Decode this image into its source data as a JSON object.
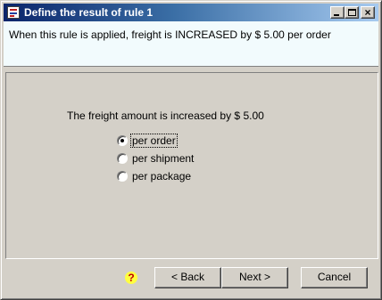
{
  "window": {
    "title": "Define the result of rule 1"
  },
  "header": {
    "text": "When this rule is applied, freight is INCREASED by $ 5.00 per order"
  },
  "body": {
    "amount_label": "The freight amount is increased by $ 5.00",
    "options": [
      {
        "label": "per order",
        "selected": true
      },
      {
        "label": "per shipment",
        "selected": false
      },
      {
        "label": "per package",
        "selected": false
      }
    ]
  },
  "footer": {
    "help_glyph": "?",
    "back_label": "< Back",
    "next_label": "Next >",
    "cancel_label": "Cancel"
  },
  "icons": {
    "app": "rule-document-icon",
    "help": "help-question-icon",
    "minimize": "minimize-icon",
    "maximize": "maximize-icon",
    "close": "close-icon"
  },
  "colors": {
    "titlebar_start": "#0a246a",
    "titlebar_end": "#a6caf0",
    "header_bg": "#f2fbfd",
    "window_bg": "#d4d0c8"
  }
}
